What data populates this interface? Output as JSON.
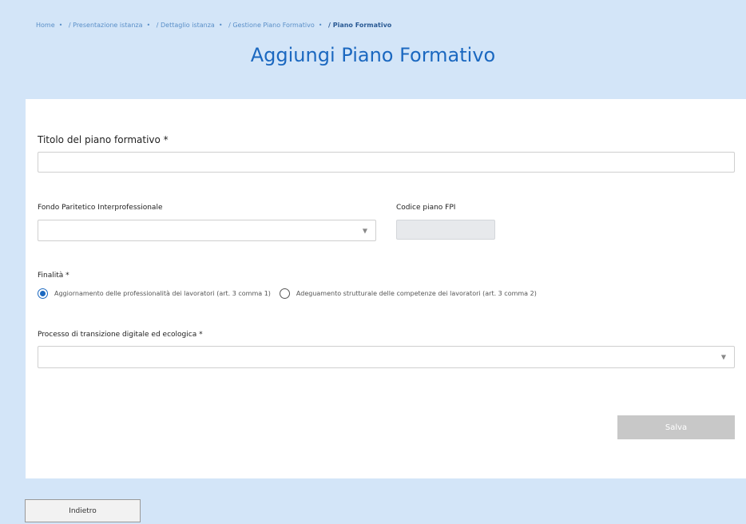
{
  "breadcrumb": {
    "items": [
      "Home",
      "/ Presentazione istanza",
      "/ Dettaglio istanza",
      "/ Gestione Piano Formativo",
      "/ Piano Formativo"
    ],
    "separator": "•"
  },
  "page": {
    "title": "Aggiungi Piano Formativo"
  },
  "form": {
    "titolo_label": "Titolo del piano formativo *",
    "titolo_value": "",
    "fondo_label": "Fondo Paritetico Interprofessionale",
    "fondo_value": "",
    "codice_label": "Codice piano FPI",
    "codice_value": "",
    "finalita_label": "Finalità *",
    "finalita_options": [
      {
        "label": "Aggiornamento delle professionalità dei lavoratori (art. 3 comma 1)",
        "checked": true
      },
      {
        "label": "Adeguamento strutturale delle competenze dei lavoratori (art. 3 comma 2)",
        "checked": false
      }
    ],
    "processo_label": "Processo di transizione digitale ed ecologica *",
    "processo_value": "",
    "caret_icon": "chevron-down-icon"
  },
  "buttons": {
    "save_label": "Salva",
    "back_label": "Indietro"
  },
  "colors": {
    "accent": "#1b68c0",
    "background": "#d3e5f8",
    "disabled_button": "#c8c8c8"
  }
}
